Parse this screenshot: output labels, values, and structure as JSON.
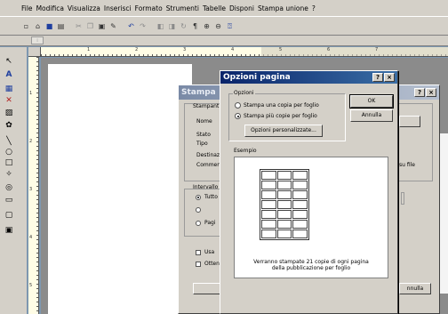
{
  "menu": [
    "File",
    "Modifica",
    "Visualizza",
    "Inserisci",
    "Formato",
    "Strumenti",
    "Tabelle",
    "Disponi",
    "Stampa unione",
    "?"
  ],
  "toolbar_icons": [
    "new-icon",
    "open-icon",
    "save-icon",
    "print-icon",
    "cut-icon",
    "copy-icon",
    "paste-icon",
    "format-painter-icon",
    "undo-icon",
    "redo-icon",
    "bring-front-icon",
    "send-back-icon",
    "rotate-icon",
    "paragraph-icon",
    "zoom-in-icon",
    "zoom-out-icon",
    "help-icon"
  ],
  "ruler": {
    "h_ticks": [
      "1",
      "2",
      "3",
      "4",
      "5",
      "6",
      "7"
    ],
    "v_ticks": [
      "1",
      "2",
      "3",
      "4",
      "5"
    ]
  },
  "print_dialog": {
    "title": "Stampa",
    "section_printer": "Stampant",
    "name_label": "Nome",
    "status_label": "Stato",
    "type_label": "Tipo",
    "dest_label": "Destinaz",
    "comment_label": "Commen",
    "interval_label": "Intervallo",
    "opt_all": "Tutto",
    "opt_pages": "Pagi",
    "chk1": "Usa",
    "chk2": "Otten",
    "file_text": "su file",
    "right_button": "nnulla"
  },
  "options_dialog": {
    "title": "Opzioni pagina",
    "help_btn": "?",
    "close_btn": "×",
    "group_label": "Opzioni",
    "radio_one": "Stampa una copia per foglio",
    "radio_multi": "Stampa più copie per foglio",
    "radio_selected": "multi",
    "custom_button": "Opzioni personalizzate...",
    "ok_button": "OK",
    "cancel_button": "Annulla",
    "preview_label": "Esempio",
    "preview_note": "Verranno stampate 21 copie di ogni pagina della pubblicazione per foglio"
  }
}
